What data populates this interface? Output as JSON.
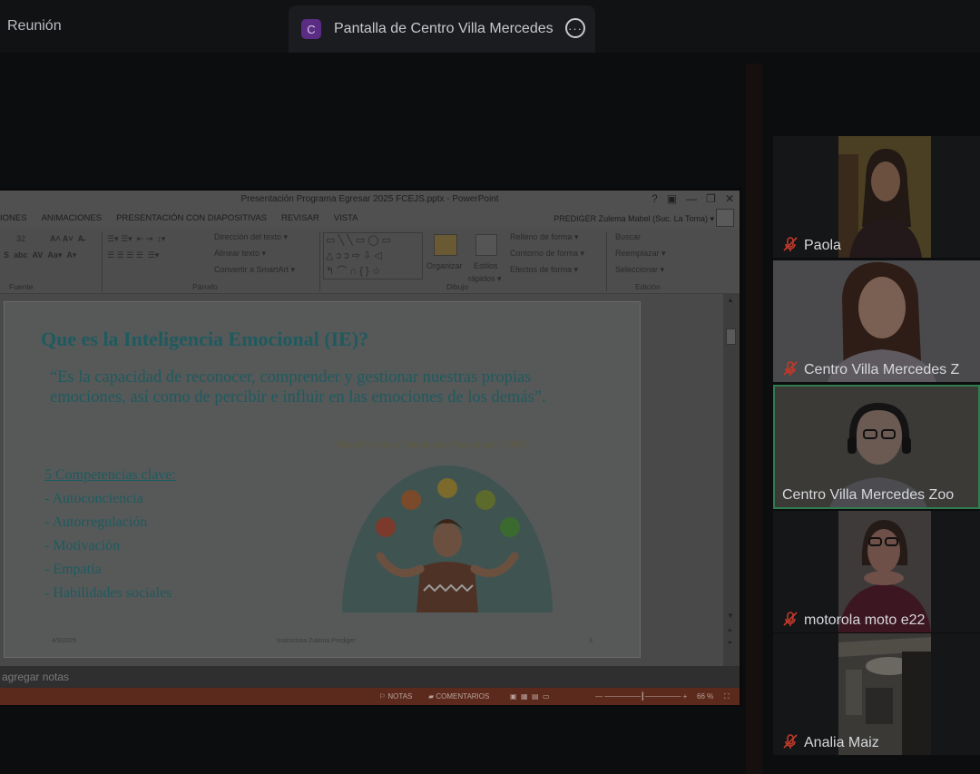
{
  "header": {
    "meeting_label": "Reunión",
    "share_badge": "C",
    "share_title": "Pantalla de Centro Villa Mercedes",
    "more_glyph": "···"
  },
  "powerpoint": {
    "window_title": "Presentación Programa Egresar  2025 FCEJS.pptx - PowerPoint",
    "window_controls": [
      "?",
      "▣",
      "—",
      "❐",
      "✕"
    ],
    "menu_items": [
      "IONES",
      "ANIMACIONES",
      "PRESENTACIÓN CON DIAPOSITIVAS",
      "REVISAR",
      "VISTA"
    ],
    "user_name": "PREDIGER Zulema Mabel (Suc. La Toma) ▾",
    "ribbon": {
      "font_size": "32",
      "paragraph_items": [
        "Dirección del texto ▾",
        "Alinear texto ▾",
        "Convertir a SmartArt ▾"
      ],
      "organize": "Organizar",
      "styles_line1": "Estilos",
      "styles_line2": "rápidos ▾",
      "drawing_items": [
        "Relleno de forma ▾",
        "Contorno de forma ▾",
        "Efectos de forma ▾"
      ],
      "editing_items": [
        "Buscar",
        "Reemplazar ▾",
        "Seleccionar ▾"
      ],
      "groups": [
        "Fuente",
        "Párrafo",
        "Dibujo",
        "Edición"
      ]
    },
    "slide": {
      "heading": "Que es la Inteligencia Emocional (IE)?",
      "quote": "“Es la capacidad de reconocer, comprender y gestionar nuestras propias emociones, así como de percibir e influir en las emociones de los demás”.",
      "citation": "Daniel Goleman \"Inteligencia Emocional\" (1995)",
      "competencies_title": "5 Competencias clave:",
      "competencies": [
        "-  Autoconciencia",
        "-  Autorregulación",
        "-  Motivación",
        "-  Empatía",
        "-  Habilidades sociales"
      ],
      "footer_date": "4/9/2025",
      "footer_center": "Instructora Zulema Prediger",
      "footer_page": "3"
    },
    "notes_placeholder": "agregar notas",
    "status_bar": {
      "notes": "NOTAS",
      "comments": "COMENTARIOS",
      "zoom": "66 %"
    }
  },
  "participants": [
    {
      "name": "Paola",
      "muted": true
    },
    {
      "name": "Centro Villa Mercedes Z",
      "muted": true
    },
    {
      "name": "Centro Villa Mercedes Zoo",
      "muted": false
    },
    {
      "name": "motorola moto e22",
      "muted": true
    },
    {
      "name": "Analia Maiz",
      "muted": true
    }
  ],
  "colors": {
    "app_background": "#0c0d0f",
    "slide_text": "#1e5a5e",
    "status_bar": "#5c2a1d",
    "active_speaker_border": "#2f7d4f",
    "muted_icon": "#c0392b"
  },
  "icons": {
    "share_more": "more-horizontal-icon",
    "muted": "mic-off-icon"
  }
}
